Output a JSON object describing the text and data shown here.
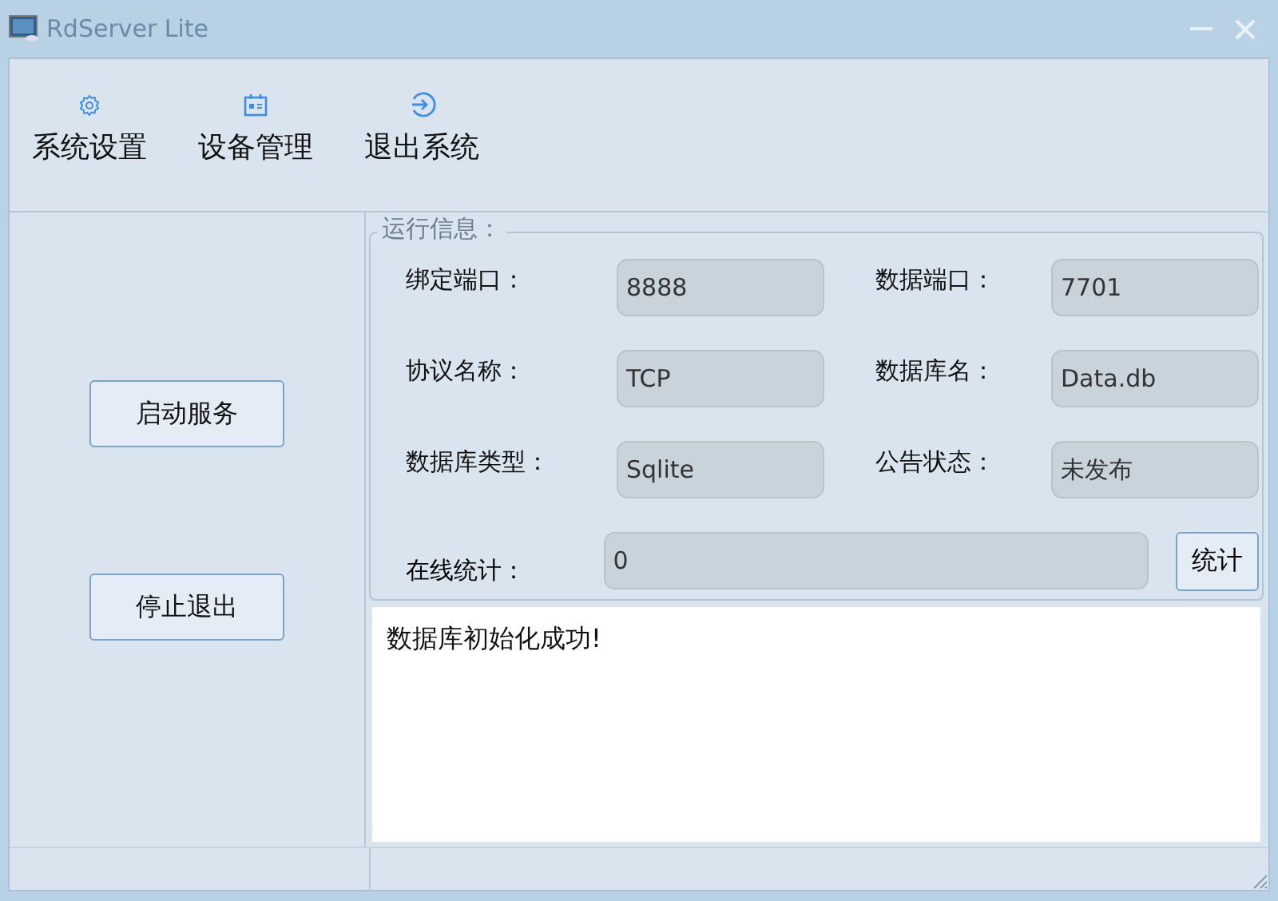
{
  "window": {
    "title": "RdServer Lite"
  },
  "toolbar": [
    {
      "label": "系统设置",
      "kind": "gear"
    },
    {
      "label": "设备管理",
      "kind": "card"
    },
    {
      "label": "退出系统",
      "kind": "exit"
    }
  ],
  "sidebar_buttons": [
    "启动服务",
    "停止退出"
  ],
  "run_info": {
    "title": "运行信息：",
    "fields": [
      {
        "label": "绑定端口：",
        "value": "8888"
      },
      {
        "label": "数据端口：",
        "value": "7701"
      },
      {
        "label": "协议名称：",
        "value": "TCP"
      },
      {
        "label": "数据库名：",
        "value": "Data.db"
      },
      {
        "label": "数据库类型：",
        "value": "Sqlite"
      },
      {
        "label": "公告状态：",
        "value": "未发布"
      }
    ],
    "online": {
      "label": "在线统计：",
      "value": "0",
      "button": "统计"
    }
  },
  "log": [
    "数据库初始化成功!"
  ]
}
